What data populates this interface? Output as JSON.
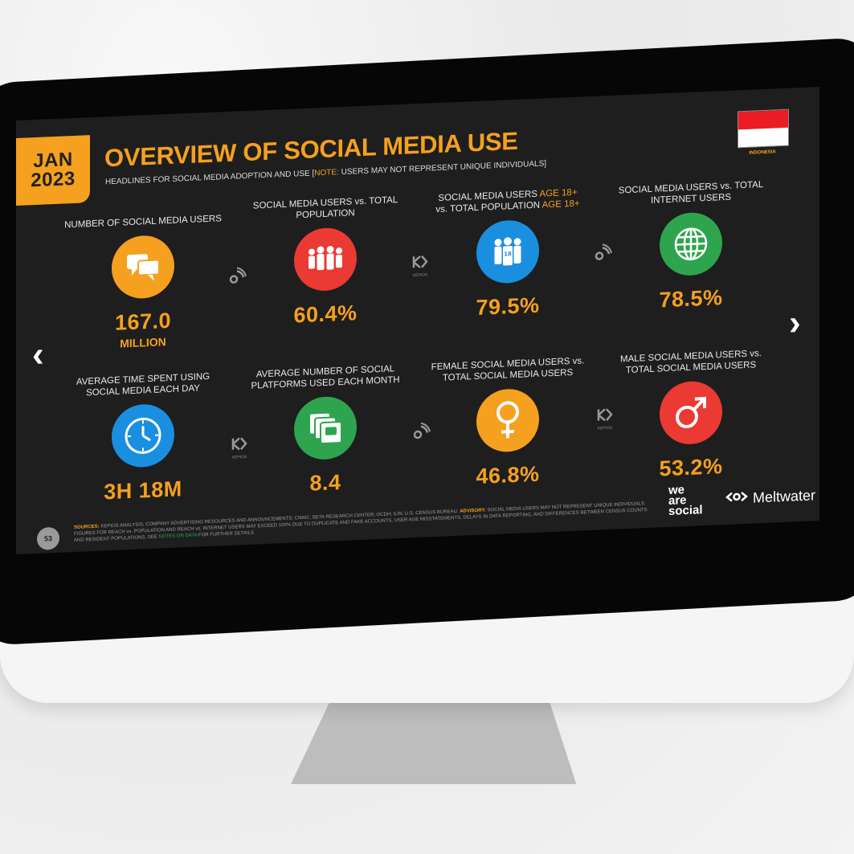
{
  "header": {
    "month": "JAN",
    "year": "2023",
    "title": "OVERVIEW OF SOCIAL MEDIA USE",
    "subtitle_prefix": "HEADLINES FOR SOCIAL MEDIA ADOPTION AND USE [",
    "subtitle_note": "NOTE:",
    "subtitle_suffix": " USERS MAY NOT REPRESENT UNIQUE INDIVIDUALS]",
    "country": "INDONESIA"
  },
  "tiles": [
    {
      "label": "NUMBER OF SOCIAL MEDIA USERS",
      "value": "167.0",
      "unit": "MILLION",
      "icon": "speech-bubbles-icon",
      "color": "#f5a01f"
    },
    {
      "label": "SOCIAL MEDIA USERS vs. TOTAL POPULATION",
      "value": "60.4%",
      "icon": "people-group-icon",
      "color": "#ea3a33"
    },
    {
      "label_a": "SOCIAL MEDIA USERS ",
      "label_a_hl": "AGE 18+",
      "label_b": "vs. TOTAL POPULATION ",
      "label_b_hl": "AGE 18+",
      "value": "79.5%",
      "icon": "adults-18-icon",
      "color": "#1a8fe0",
      "badge": "18"
    },
    {
      "label": "SOCIAL MEDIA USERS vs. TOTAL INTERNET USERS",
      "value": "78.5%",
      "icon": "globe-icon",
      "color": "#2ea44f"
    },
    {
      "label": "AVERAGE TIME SPENT USING SOCIAL MEDIA EACH DAY",
      "value": "3H 18M",
      "icon": "clock-icon",
      "color": "#1a8fe0"
    },
    {
      "label": "AVERAGE NUMBER OF SOCIAL PLATFORMS USED EACH MONTH",
      "value": "8.4",
      "icon": "stacked-apps-icon",
      "color": "#2ea44f"
    },
    {
      "label": "FEMALE SOCIAL MEDIA USERS vs. TOTAL SOCIAL MEDIA USERS",
      "value": "46.8%",
      "icon": "female-symbol-icon",
      "color": "#f5a01f"
    },
    {
      "label": "MALE SOCIAL MEDIA USERS vs. TOTAL SOCIAL MEDIA USERS",
      "value": "53.2%",
      "icon": "male-symbol-icon",
      "color": "#ea3a33"
    }
  ],
  "separators": {
    "kepios": "KEPIOS"
  },
  "footer": {
    "page_number": "53",
    "sources_label": "SOURCES:",
    "sources_text": " KEPIOS ANALYSIS; COMPANY ADVERTISING RESOURCES AND ANNOUNCEMENTS; CNNIC; BETA RESEARCH CENTER; OCDH; ILIN; U.S. CENSUS BUREAU. ",
    "advisory_label": "ADVISORY:",
    "advisory_text": " SOCIAL MEDIA USERS MAY NOT REPRESENT UNIQUE INDIVIDUALS. FIGURES FOR REACH vs. POPULATION AND REACH vs. INTERNET USERS MAY EXCEED 100% DUE TO DUPLICATE AND FAKE ACCOUNTS, USER AGE MISSTATEMENTS, DELAYS IN DATA REPORTING, AND DIFFERENCES BETWEEN CENSUS COUNTS AND RESIDENT POPULATIONS. SEE ",
    "notes_link": "NOTES ON DATA",
    "notes_suffix": " FOR FURTHER DETAILS",
    "brand_1_line1": "we",
    "brand_1_line2": "are",
    "brand_1_line3": "social",
    "brand_2": "Meltwater"
  },
  "nav": {
    "prev": "‹",
    "next": "›"
  }
}
